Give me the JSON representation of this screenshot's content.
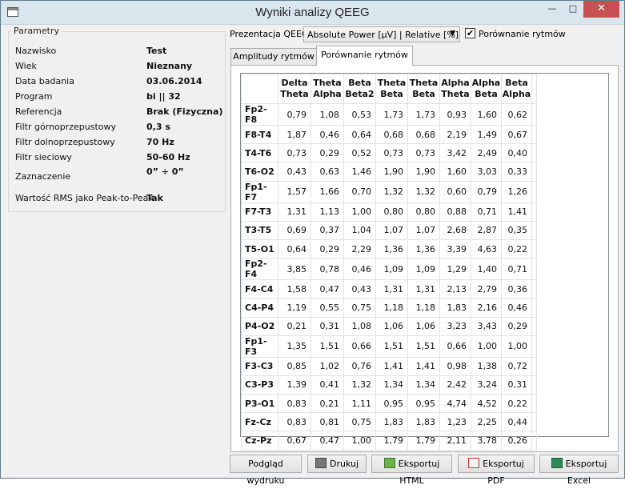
{
  "window": {
    "title": "Wyniki analizy QEEG",
    "min": "—",
    "max": "□",
    "close": "✕"
  },
  "params": {
    "group_title": "Parametry",
    "rows": [
      {
        "label": "Nazwisko",
        "value": "Test"
      },
      {
        "label": "Wiek",
        "value": "Nieznany"
      },
      {
        "label": "Data badania",
        "value": "03.06.2014"
      },
      {
        "label": "Program",
        "value": "bi || 32"
      },
      {
        "label": "Referencja",
        "value": "Brak (Fizyczna)"
      },
      {
        "label": "Filtr górnoprzepustowy",
        "value": "0,3 s"
      },
      {
        "label": "Filtr dolnoprzepustowy",
        "value": "70 Hz"
      },
      {
        "label": "Filtr sieciowy",
        "value": "50-60 Hz"
      },
      {
        "label": "Zaznaczenie",
        "value": "0” ÷ 0”"
      },
      {
        "label": "Wartość RMS jako Peak-to-Peak",
        "value": "Tak"
      }
    ]
  },
  "presentation": {
    "label": "Prezentacja QEEG",
    "selected": "Absolute Power [μV] | Relative [%]",
    "checkbox_checked": true,
    "checkbox_label": "Porównanie rytmów"
  },
  "tabs": [
    {
      "label": "Amplitudy rytmów",
      "active": false
    },
    {
      "label": "Porównanie rytmów",
      "active": true
    }
  ],
  "grid": {
    "columns": [
      {
        "l1": "Delta",
        "l2": "Theta"
      },
      {
        "l1": "Theta",
        "l2": "Alpha"
      },
      {
        "l1": "Beta",
        "l2": "Beta2"
      },
      {
        "l1": "Theta",
        "l2": "Beta"
      },
      {
        "l1": "Theta",
        "l2": "Beta"
      },
      {
        "l1": "Alpha",
        "l2": "Theta"
      },
      {
        "l1": "Alpha",
        "l2": "Beta"
      },
      {
        "l1": "Beta",
        "l2": "Alpha"
      }
    ],
    "rows": [
      {
        "name": "Fp2-F8",
        "v": [
          "0,79",
          "1,08",
          "0,53",
          "1,73",
          "1,73",
          "0,93",
          "1,60",
          "0,62"
        ]
      },
      {
        "name": "F8-T4",
        "v": [
          "1,87",
          "0,46",
          "0,64",
          "0,68",
          "0,68",
          "2,19",
          "1,49",
          "0,67"
        ]
      },
      {
        "name": "T4-T6",
        "v": [
          "0,73",
          "0,29",
          "0,52",
          "0,73",
          "0,73",
          "3,42",
          "2,49",
          "0,40"
        ]
      },
      {
        "name": "T6-O2",
        "v": [
          "0,43",
          "0,63",
          "1,46",
          "1,90",
          "1,90",
          "1,60",
          "3,03",
          "0,33"
        ]
      },
      {
        "name": "Fp1-F7",
        "v": [
          "1,57",
          "1,66",
          "0,70",
          "1,32",
          "1,32",
          "0,60",
          "0,79",
          "1,26"
        ]
      },
      {
        "name": "F7-T3",
        "v": [
          "1,31",
          "1,13",
          "1,00",
          "0,80",
          "0,80",
          "0,88",
          "0,71",
          "1,41"
        ]
      },
      {
        "name": "T3-T5",
        "v": [
          "0,69",
          "0,37",
          "1,04",
          "1,07",
          "1,07",
          "2,68",
          "2,87",
          "0,35"
        ]
      },
      {
        "name": "T5-O1",
        "v": [
          "0,64",
          "0,29",
          "2,29",
          "1,36",
          "1,36",
          "3,39",
          "4,63",
          "0,22"
        ]
      },
      {
        "name": "Fp2-F4",
        "v": [
          "3,85",
          "0,78",
          "0,46",
          "1,09",
          "1,09",
          "1,29",
          "1,40",
          "0,71"
        ]
      },
      {
        "name": "F4-C4",
        "v": [
          "1,58",
          "0,47",
          "0,43",
          "1,31",
          "1,31",
          "2,13",
          "2,79",
          "0,36"
        ]
      },
      {
        "name": "C4-P4",
        "v": [
          "1,19",
          "0,55",
          "0,75",
          "1,18",
          "1,18",
          "1,83",
          "2,16",
          "0,46"
        ]
      },
      {
        "name": "P4-O2",
        "v": [
          "0,21",
          "0,31",
          "1,08",
          "1,06",
          "1,06",
          "3,23",
          "3,43",
          "0,29"
        ]
      },
      {
        "name": "Fp1-F3",
        "v": [
          "1,35",
          "1,51",
          "0,66",
          "1,51",
          "1,51",
          "0,66",
          "1,00",
          "1,00"
        ]
      },
      {
        "name": "F3-C3",
        "v": [
          "0,85",
          "1,02",
          "0,76",
          "1,41",
          "1,41",
          "0,98",
          "1,38",
          "0,72"
        ]
      },
      {
        "name": "C3-P3",
        "v": [
          "1,39",
          "0,41",
          "1,32",
          "1,34",
          "1,34",
          "2,42",
          "3,24",
          "0,31"
        ]
      },
      {
        "name": "P3-O1",
        "v": [
          "0,83",
          "0,21",
          "1,11",
          "0,95",
          "0,95",
          "4,74",
          "4,52",
          "0,22"
        ]
      },
      {
        "name": "Fz-Cz",
        "v": [
          "0,83",
          "0,81",
          "0,75",
          "1,83",
          "1,83",
          "1,23",
          "2,25",
          "0,44"
        ]
      },
      {
        "name": "Cz-Pz",
        "v": [
          "0,67",
          "0,47",
          "1,00",
          "1,79",
          "1,79",
          "2,11",
          "3,78",
          "0,26"
        ]
      }
    ]
  },
  "buttons": {
    "preview": "Podgląd wydruku",
    "print": "Drukuj",
    "html": "Eksportuj HTML",
    "pdf": "Eksportuj PDF",
    "excel": "Eksportuj Excel"
  }
}
